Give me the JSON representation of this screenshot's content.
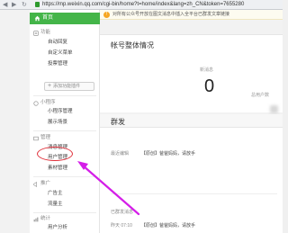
{
  "browser": {
    "url": "https://mp.weixin.qq.com/cgi-bin/home?t=home/index&lang=zh_CN&token=7655280"
  },
  "notice": {
    "text": "对所有公众号开放在图文消息中插入全平台已群发文章链接"
  },
  "sidebar": {
    "home_label": "首页",
    "sections": [
      {
        "title": "功能",
        "items": [
          "自动回复",
          "自定义菜单",
          "投票管理"
        ]
      },
      {
        "title": "小程序",
        "items": [
          "小程序管理",
          "展示场景"
        ]
      },
      {
        "title": "管理",
        "items": [
          "消息管理",
          "用户管理",
          "素材管理"
        ]
      },
      {
        "title": "推广",
        "items": [
          "广告主",
          "流量主"
        ]
      },
      {
        "title": "统计",
        "items": [
          "用户分析"
        ]
      }
    ],
    "add_plugin_label": "添加功能插件"
  },
  "overview": {
    "title": "帐号整体情况",
    "unread_label": "新消息",
    "unread_count": "0",
    "total_users_label": "总用户数"
  },
  "broadcast": {
    "title": "群发",
    "recent_label": "最近编辑",
    "recent_tag": "【原创】",
    "recent_title": "爸爸妈妈，请放手",
    "sent_header": "已群发消息",
    "sent_time": "昨天 07:10",
    "sent_tag": "【原创】",
    "sent_title": "爸爸妈妈，请放手"
  },
  "colors": {
    "accent_green": "#44b549",
    "annotation_red": "#e0303a",
    "annotation_purple": "#d41ee8"
  }
}
